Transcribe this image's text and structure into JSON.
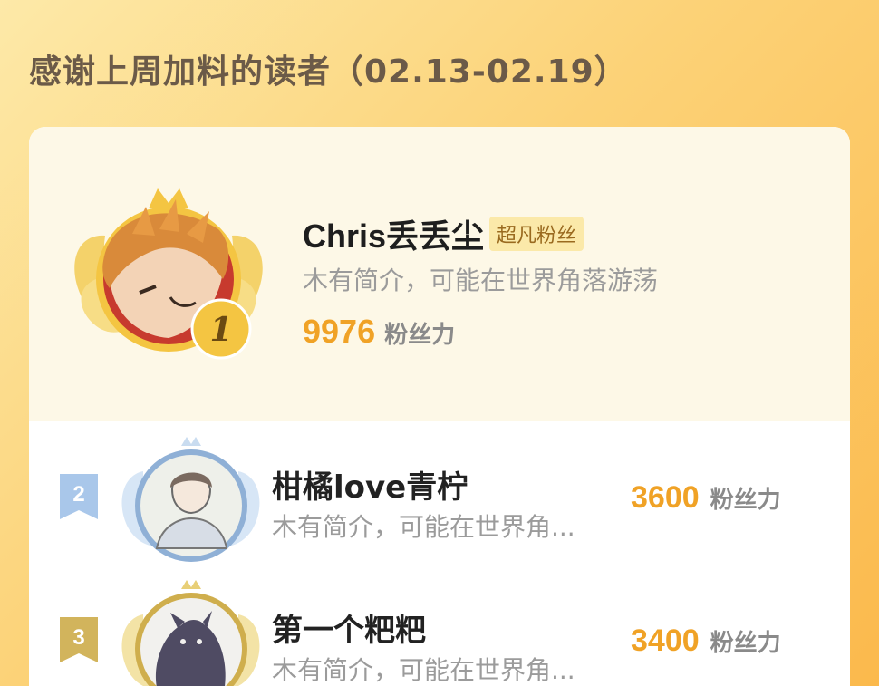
{
  "header": {
    "title": "感谢上周加料的读者（02.13-02.19）"
  },
  "ranking": [
    {
      "rank": "1",
      "name": "Chris丢丢尘",
      "tag": "超凡粉丝",
      "intro": "木有简介，可能在世界角落游荡",
      "score": "9976",
      "unit": "粉丝力"
    },
    {
      "rank": "2",
      "name": "柑橘love青柠",
      "intro": "木有简介，可能在世界角...",
      "score": "3600",
      "unit": "粉丝力"
    },
    {
      "rank": "3",
      "name": "第一个粑粑",
      "intro": "木有简介，可能在世界角...",
      "score": "3400",
      "unit": "粉丝力"
    }
  ],
  "colors": {
    "accent": "#f0a226",
    "gold": "#f4c542",
    "silver": "#9cc0e6",
    "bronze": "#cfae4d"
  },
  "icons": [
    "crown-icon",
    "laurel-wings-icon",
    "rank-medal-icon",
    "rank-flag-icon"
  ]
}
